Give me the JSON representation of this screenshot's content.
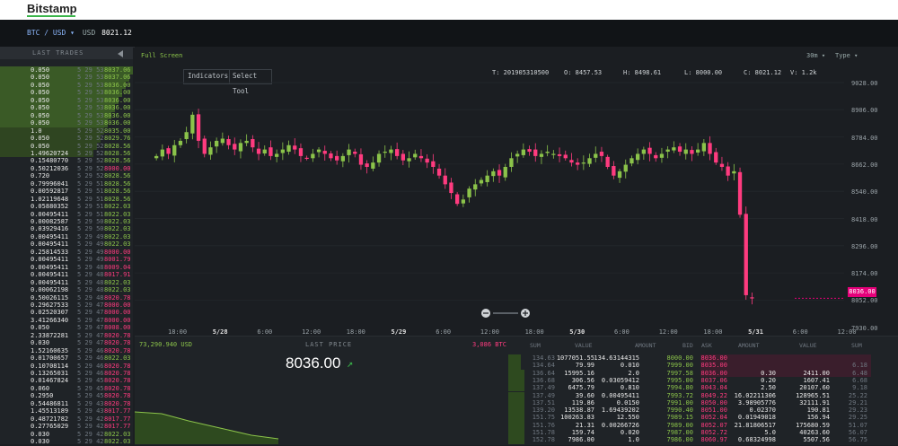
{
  "header": {
    "brand": "Bitstamp"
  },
  "pair": {
    "label": "BTC / USD",
    "currency": "USD",
    "price": "8021.12"
  },
  "trades": {
    "title": "LAST TRADES",
    "rows": [
      {
        "a": "0.050",
        "t": "5 29 53",
        "p": "8037.06",
        "c": "up"
      },
      {
        "a": "0.050",
        "t": "5 29 53",
        "p": "8037.06",
        "c": "up"
      },
      {
        "a": "0.050",
        "t": "5 29 53",
        "p": "8036.00",
        "c": "up"
      },
      {
        "a": "0.050",
        "t": "5 29 53",
        "p": "8036.00",
        "c": "up"
      },
      {
        "a": "0.050",
        "t": "5 29 53",
        "p": "8036.00",
        "c": "up"
      },
      {
        "a": "0.050",
        "t": "5 29 53",
        "p": "8036.00",
        "c": "up"
      },
      {
        "a": "0.050",
        "t": "5 29 53",
        "p": "8036.00",
        "c": "up"
      },
      {
        "a": "0.050",
        "t": "5 29 53",
        "p": "8036.00",
        "c": "up"
      },
      {
        "a": "1.0",
        "t": "5 29 52",
        "p": "8035.00",
        "c": "up"
      },
      {
        "a": "0.050",
        "t": "5 29 52",
        "p": "8029.76",
        "c": "up"
      },
      {
        "a": "0.050",
        "t": "5 29 52",
        "p": "8028.56",
        "c": "up"
      },
      {
        "a": "1.49620724",
        "t": "5 29 52",
        "p": "8028.56",
        "c": "up"
      },
      {
        "a": "0.15480770",
        "t": "5 29 52",
        "p": "8028.56",
        "c": "up"
      },
      {
        "a": "0.50212036",
        "t": "5 29 52",
        "p": "8000.00",
        "c": "dn"
      },
      {
        "a": "0.720",
        "t": "5 29 52",
        "p": "8028.56",
        "c": "up"
      },
      {
        "a": "0.79996041",
        "t": "5 29 51",
        "p": "8028.56",
        "c": "up"
      },
      {
        "a": "0.00592817",
        "t": "5 29 51",
        "p": "8028.56",
        "c": "up"
      },
      {
        "a": "1.02119648",
        "t": "5 29 51",
        "p": "8028.56",
        "c": "up"
      },
      {
        "a": "0.05880352",
        "t": "5 29 51",
        "p": "8022.03",
        "c": "up"
      },
      {
        "a": "0.00495411",
        "t": "5 29 51",
        "p": "8022.03",
        "c": "up"
      },
      {
        "a": "0.00082587",
        "t": "5 29 50",
        "p": "8022.03",
        "c": "up"
      },
      {
        "a": "0.03929416",
        "t": "5 29 50",
        "p": "8022.03",
        "c": "up"
      },
      {
        "a": "0.00495411",
        "t": "5 29 49",
        "p": "8022.03",
        "c": "up"
      },
      {
        "a": "0.00495411",
        "t": "5 29 49",
        "p": "8022.03",
        "c": "up"
      },
      {
        "a": "0.25814533",
        "t": "5 29 49",
        "p": "8000.00",
        "c": "dn"
      },
      {
        "a": "0.00495411",
        "t": "5 29 49",
        "p": "8001.79",
        "c": "dn"
      },
      {
        "a": "0.00495411",
        "t": "5 29 48",
        "p": "8009.04",
        "c": "dn"
      },
      {
        "a": "0.00495411",
        "t": "5 29 48",
        "p": "8017.91",
        "c": "dn"
      },
      {
        "a": "0.00495411",
        "t": "5 29 48",
        "p": "8022.03",
        "c": "up"
      },
      {
        "a": "0.00062198",
        "t": "5 29 48",
        "p": "8022.03",
        "c": "up"
      },
      {
        "a": "0.50026115",
        "t": "5 29 48",
        "p": "8020.78",
        "c": "dn"
      },
      {
        "a": "0.29627533",
        "t": "5 29 47",
        "p": "8000.00",
        "c": "dn"
      },
      {
        "a": "0.02520307",
        "t": "5 29 47",
        "p": "8000.00",
        "c": "dn"
      },
      {
        "a": "3.41266340",
        "t": "5 29 47",
        "p": "8000.00",
        "c": "dn"
      },
      {
        "a": "0.050",
        "t": "5 29 47",
        "p": "8008.00",
        "c": "dn"
      },
      {
        "a": "2.33872281",
        "t": "5 29 47",
        "p": "8020.78",
        "c": "dn"
      },
      {
        "a": "0.030",
        "t": "5 29 47",
        "p": "8020.78",
        "c": "dn"
      },
      {
        "a": "1.52160635",
        "t": "5 29 46",
        "p": "8020.78",
        "c": "dn"
      },
      {
        "a": "0.01700657",
        "t": "5 29 46",
        "p": "8022.03",
        "c": "up"
      },
      {
        "a": "0.10708114",
        "t": "5 29 46",
        "p": "8020.78",
        "c": "dn"
      },
      {
        "a": "0.13265031",
        "t": "5 29 46",
        "p": "8020.78",
        "c": "dn"
      },
      {
        "a": "0.01467824",
        "t": "5 29 45",
        "p": "8020.78",
        "c": "dn"
      },
      {
        "a": "0.060",
        "t": "5 29 45",
        "p": "8020.78",
        "c": "dn"
      },
      {
        "a": "0.2950",
        "t": "5 29 45",
        "p": "8020.78",
        "c": "dn"
      },
      {
        "a": "0.54486811",
        "t": "5 29 43",
        "p": "8020.78",
        "c": "dn"
      },
      {
        "a": "1.45513189",
        "t": "5 29 43",
        "p": "8017.77",
        "c": "dn"
      },
      {
        "a": "0.48721782",
        "t": "5 29 42",
        "p": "8017.77",
        "c": "dn"
      },
      {
        "a": "0.27765029",
        "t": "5 29 42",
        "p": "8017.77",
        "c": "dn"
      },
      {
        "a": "0.030",
        "t": "5 29 42",
        "p": "8022.03",
        "c": "up"
      },
      {
        "a": "0.030",
        "t": "5 29 42",
        "p": "8022.03",
        "c": "up"
      }
    ]
  },
  "chart": {
    "fullscreen": "Full Screen",
    "interval": "30m",
    "type": "Type",
    "menu": {
      "indicators": "Indicators",
      "select": "Select",
      "tool": "Tool"
    },
    "ohlc": {
      "t": "T: 201905310500",
      "o": "O: 8457.53",
      "h": "H: 8498.61",
      "l": "L: 8000.00",
      "c": "C: 8021.12",
      "v": "V: 1.2k"
    },
    "last_price_badge": "8036.00"
  },
  "chart_data": {
    "type": "candlestick",
    "y_ticks": [
      "9028.00",
      "8906.00",
      "8784.00",
      "8662.00",
      "8540.00",
      "8418.00",
      "8296.00",
      "8174.00",
      "8052.00",
      "7930.00"
    ],
    "x_ticks": [
      {
        "label": "18:00",
        "bold": false
      },
      {
        "label": "5/28",
        "bold": true
      },
      {
        "label": "6:00",
        "bold": false
      },
      {
        "label": "12:00",
        "bold": false
      },
      {
        "label": "18:00",
        "bold": false
      },
      {
        "label": "5/29",
        "bold": true
      },
      {
        "label": "6:00",
        "bold": false
      },
      {
        "label": "12:00",
        "bold": false
      },
      {
        "label": "18:00",
        "bold": false
      },
      {
        "label": "5/30",
        "bold": true
      },
      {
        "label": "6:00",
        "bold": false
      },
      {
        "label": "12:00",
        "bold": false
      },
      {
        "label": "18:00",
        "bold": false
      },
      {
        "label": "5/31",
        "bold": true
      },
      {
        "label": "6:00",
        "bold": false
      },
      {
        "label": "12:00",
        "bold": false
      }
    ],
    "ylim": [
      7930,
      9028
    ],
    "close_path": [
      8690,
      8720,
      8700,
      8740,
      8760,
      8800,
      8880,
      8760,
      8700,
      8730,
      8760,
      8770,
      8740,
      8720,
      8750,
      8760,
      8730,
      8700,
      8720,
      8690,
      8700,
      8720,
      8740,
      8720,
      8690,
      8680,
      8700,
      8720,
      8700,
      8680,
      8670,
      8690,
      8720,
      8700,
      8650,
      8640,
      8660,
      8700,
      8710,
      8720,
      8690,
      8670,
      8680,
      8700,
      8680,
      8660,
      8640,
      8600,
      8560,
      8520,
      8470,
      8490,
      8540,
      8560,
      8580,
      8600,
      8620,
      8600,
      8640,
      8680,
      8700,
      8720,
      8710,
      8690,
      8700,
      8710,
      8700,
      8690,
      8680,
      8660,
      8650,
      8660,
      8680,
      8700,
      8690,
      8640,
      8600,
      8620,
      8650,
      8680,
      8700,
      8720,
      8700,
      8680,
      8700,
      8720,
      8730,
      8710,
      8720,
      8700,
      8720,
      8750,
      8700,
      8660,
      8640,
      8600,
      8620,
      8420,
      8050,
      8036
    ]
  },
  "bottom": {
    "depth_left": "73,290.940 USD",
    "depth_right": "3,086 BTC",
    "last_price_label": "LAST PRICE",
    "last_price": "8036.00",
    "headers_left": [
      "SUM",
      "VALUE",
      "AMOUNT",
      "BID"
    ],
    "headers_right": [
      "ASK",
      "AMOUNT",
      "VALUE",
      "SUM"
    ],
    "bids": [
      {
        "sum": "134.63",
        "value": "1077051.55",
        "amount": "134.63144315",
        "price": "8000.00"
      },
      {
        "sum": "134.64",
        "value": "79.99",
        "amount": "0.010",
        "price": "7999.00"
      },
      {
        "sum": "136.64",
        "value": "15995.16",
        "amount": "2.0",
        "price": "7997.58"
      },
      {
        "sum": "136.68",
        "value": "306.56",
        "amount": "0.03059412",
        "price": "7995.00"
      },
      {
        "sum": "137.49",
        "value": "6475.79",
        "amount": "0.810",
        "price": "7994.80"
      },
      {
        "sum": "137.49",
        "value": "39.60",
        "amount": "0.00495411",
        "price": "7993.72"
      },
      {
        "sum": "137.51",
        "value": "119.86",
        "amount": "0.0150",
        "price": "7991.00"
      },
      {
        "sum": "139.20",
        "value": "13538.87",
        "amount": "1.69439202",
        "price": "7990.40"
      },
      {
        "sum": "151.75",
        "value": "100263.83",
        "amount": "12.550",
        "price": "7989.15"
      },
      {
        "sum": "151.76",
        "value": "21.31",
        "amount": "0.00266726",
        "price": "7989.00"
      },
      {
        "sum": "151.78",
        "value": "159.74",
        "amount": "0.020",
        "price": "7987.00"
      },
      {
        "sum": "152.78",
        "value": "7986.00",
        "amount": "1.0",
        "price": "7986.00"
      }
    ],
    "asks": [
      {
        "price": "8036.00",
        "amount": "",
        "value": "",
        "sum": ""
      },
      {
        "price": "8035.00",
        "amount": "",
        "value": "",
        "sum": "6.18"
      },
      {
        "price": "8036.00",
        "amount": "0.30",
        "value": "2411.00",
        "sum": "6.48"
      },
      {
        "price": "8037.06",
        "amount": "0.20",
        "value": "1607.41",
        "sum": "6.68"
      },
      {
        "price": "8043.04",
        "amount": "2.50",
        "value": "20107.60",
        "sum": "9.18"
      },
      {
        "price": "8049.22",
        "amount": "16.02211306",
        "value": "128965.51",
        "sum": "25.22"
      },
      {
        "price": "8050.00",
        "amount": "3.98905776",
        "value": "32111.91",
        "sum": "29.21"
      },
      {
        "price": "8051.00",
        "amount": "0.02370",
        "value": "190.81",
        "sum": "29.23"
      },
      {
        "price": "8052.04",
        "amount": "0.01949018",
        "value": "156.94",
        "sum": "29.25"
      },
      {
        "price": "8052.07",
        "amount": "21.81806517",
        "value": "175680.59",
        "sum": "51.07"
      },
      {
        "price": "8052.72",
        "amount": "5.0",
        "value": "40263.60",
        "sum": "56.07"
      },
      {
        "price": "8060.97",
        "amount": "0.68324998",
        "value": "5507.56",
        "sum": "56.75"
      }
    ]
  },
  "colors": {
    "up": "#8bc34a",
    "down": "#ff3b7f",
    "accent": "#e6007a",
    "brand": "#3ab54a"
  }
}
